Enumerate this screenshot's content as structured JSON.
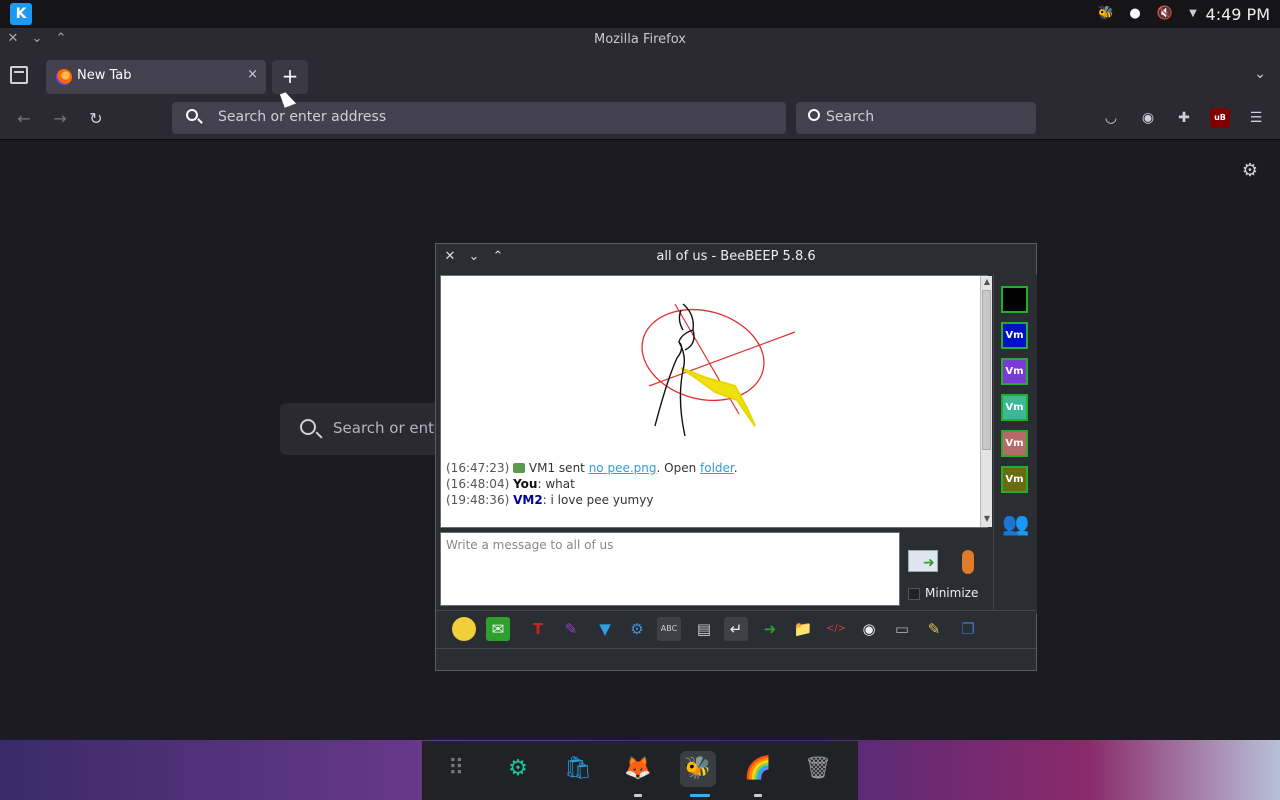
{
  "system_panel": {
    "launcher_label": "K",
    "clock": "4:49 PM",
    "tray": [
      "beebeep-tray-icon",
      "color-wheel-icon",
      "muted-speaker-icon",
      "chevron-down-icon"
    ]
  },
  "firefox": {
    "window_title": "Mozilla Firefox",
    "tab": {
      "label": "New Tab",
      "close": "×"
    },
    "new_tab": "+",
    "urlbar_placeholder": "Search or enter address",
    "searchbar_placeholder": "Search",
    "hero_search_placeholder": "Search or enter address"
  },
  "beebeep": {
    "window_title": "all of us - BeeBEEP 5.8.6",
    "messages": [
      {
        "time": "(16:47:23)",
        "pre": "VM1 sent ",
        "link": "no pee.png",
        "mid": ". Open ",
        "link2": "folder",
        "post": "."
      },
      {
        "time": "(16:48:04)",
        "who": "You",
        "text": ": what"
      },
      {
        "time": "(19:48:36)",
        "who": "VM2",
        "text": ": i love pee yumyy"
      }
    ],
    "input_placeholder": "Write a message to all of us",
    "minimize_label": "Minimize",
    "users": [
      {
        "label": "",
        "bg": "#000000"
      },
      {
        "label": "Vm",
        "bg": "#0010c8"
      },
      {
        "label": "Vm",
        "bg": "#7a3ad8"
      },
      {
        "label": "Vm",
        "bg": "#3ab898"
      },
      {
        "label": "Vm",
        "bg": "#b86a6a"
      },
      {
        "label": "Vm",
        "bg": "#6a6a10"
      }
    ]
  },
  "colors": {
    "firefox_bg": "#1c1b22",
    "toolbar_bg": "#2b2a33",
    "beebeep_link": "#2e9fd8",
    "user_border": "#24b026"
  }
}
